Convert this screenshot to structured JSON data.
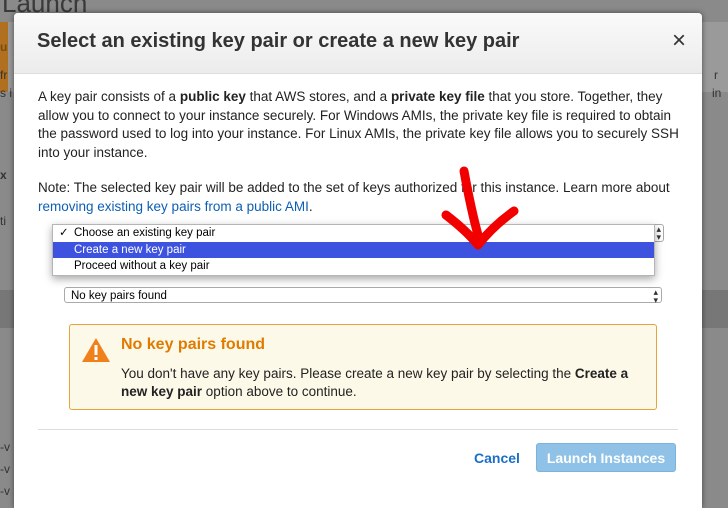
{
  "background": {
    "title": "Launch",
    "fragments": [
      "u",
      "fr",
      "s i",
      "x",
      "ti",
      "-v",
      "-v",
      "-v",
      "r",
      "in"
    ]
  },
  "modal": {
    "title": "Select an existing key pair or create a new key pair",
    "close_label": "×",
    "intro": {
      "p1": "A key pair consists of a ",
      "b1": "public key",
      "p2": " that AWS stores, and a ",
      "b2": "private key file",
      "p3": " that you store. Together, they allow you to connect to your instance securely. For Windows AMIs, the private key file is required to obtain the password used to log into your instance. For Linux AMIs, the private key file allows you to securely SSH into your instance."
    },
    "note": {
      "text": "Note: The selected key pair will be added to the set of keys authorized for this instance. Learn more about ",
      "link": "removing existing key pairs from a public AMI",
      "end": "."
    },
    "key_pair_dropdown": {
      "options": [
        "Choose an existing key pair",
        "Create a new key pair",
        "Proceed without a key pair"
      ],
      "checked_index": 0,
      "highlighted_index": 1,
      "check_mark": "✓"
    },
    "key_pair_select": {
      "value": "No key pairs found"
    },
    "alert": {
      "title": "No key pairs found",
      "text1": "You don't have any key pairs. Please create a new key pair by selecting the ",
      "bold": "Create a new key pair",
      "text2": " option above to continue."
    },
    "footer": {
      "cancel_label": "Cancel",
      "launch_label": "Launch Instances"
    }
  },
  "colors": {
    "link": "#0e5fb3",
    "alert_title": "#e07b00",
    "highlight": "#3d53e0",
    "launch_button": "#8fc2e6"
  }
}
